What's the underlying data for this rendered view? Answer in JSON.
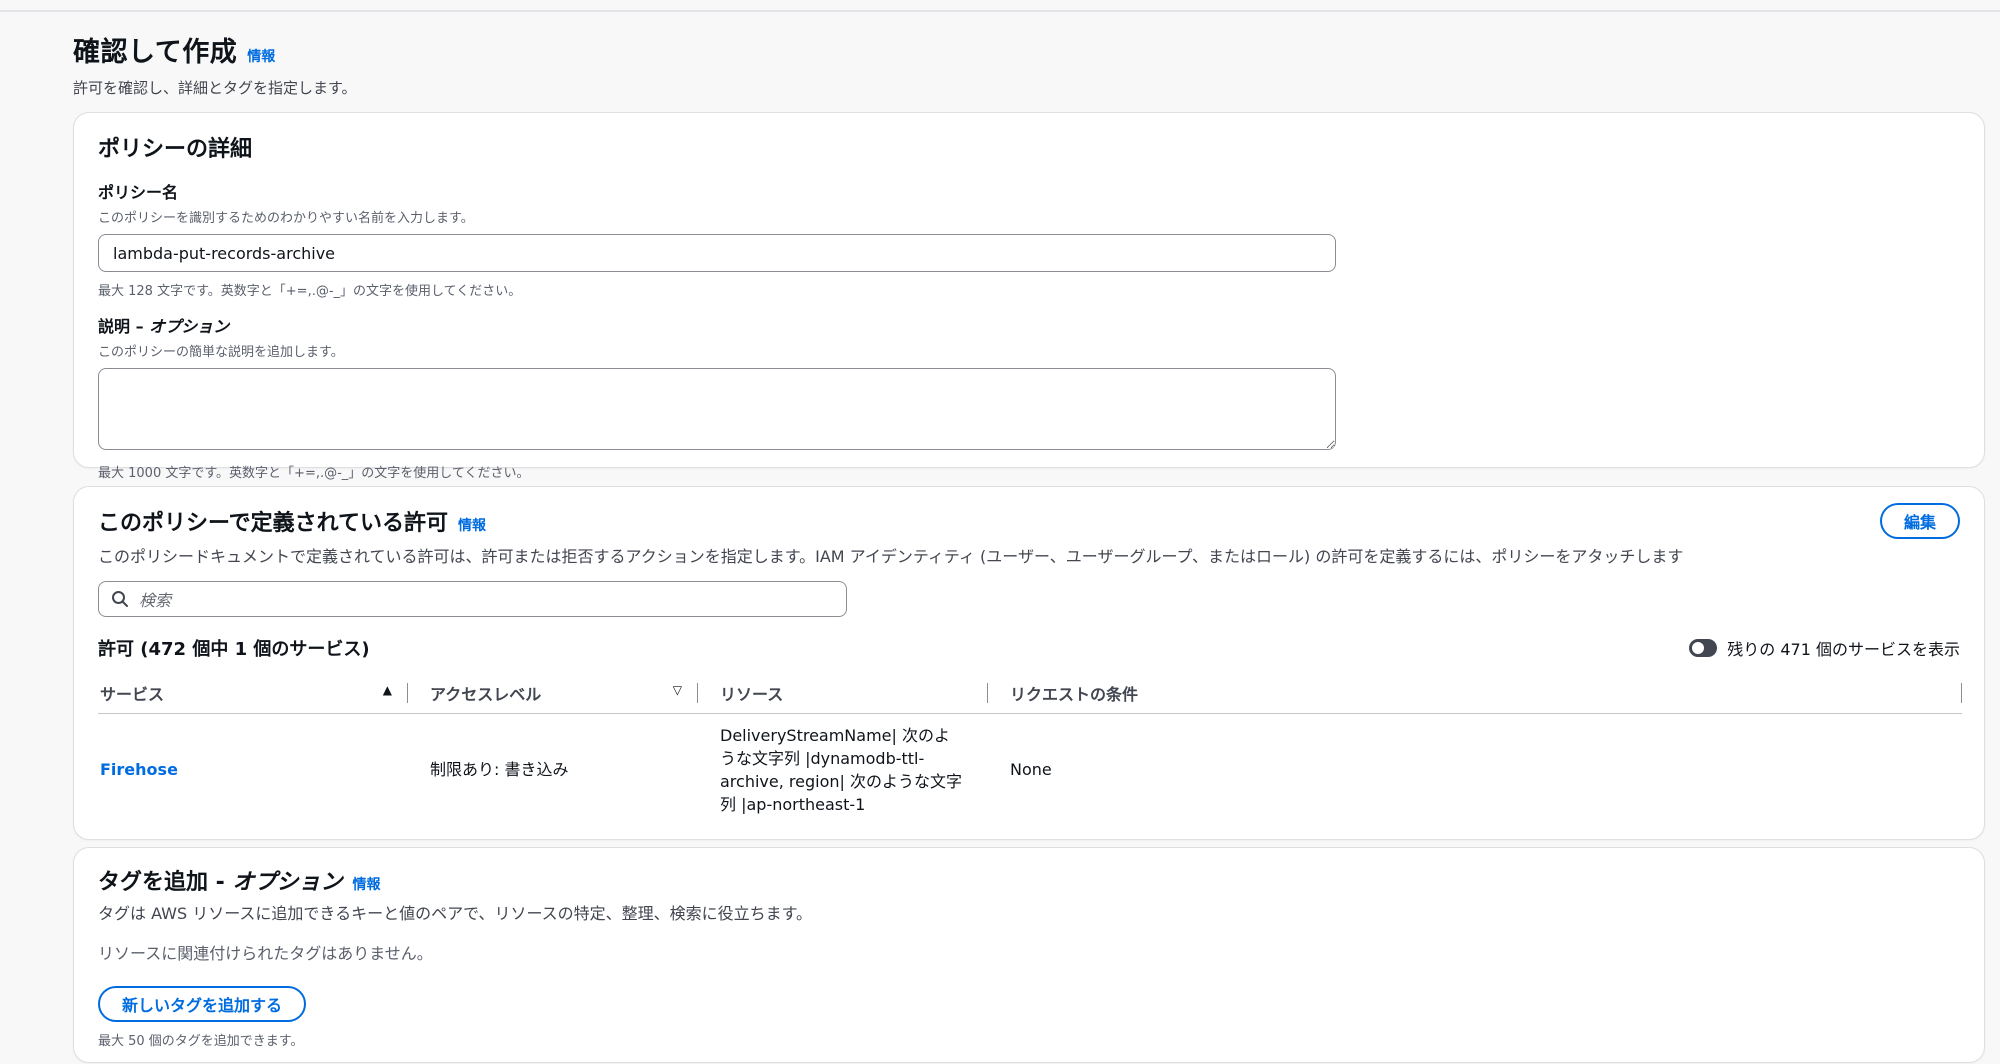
{
  "header": {
    "title": "確認して作成",
    "info": "情報",
    "description": "許可を確認し、詳細とタグを指定します。"
  },
  "policy_details": {
    "title": "ポリシーの詳細",
    "name_label": "ポリシー名",
    "name_desc": "このポリシーを識別するためのわかりやすい名前を入力します。",
    "name_value": "lambda-put-records-archive",
    "name_constraint": "最大 128 文字です。英数字と「+=,.@-_」の文字を使用してください。",
    "desc_label": "説明 – ",
    "desc_label_optional": "オプション",
    "desc_desc": "このポリシーの簡単な説明を追加します。",
    "desc_value": "",
    "desc_constraint": "最大 1000 文字です。英数字と「+=,.@-_」の文字を使用してください。"
  },
  "permissions": {
    "title": "このポリシーで定義されている許可",
    "info": "情報",
    "edit_label": "編集",
    "description": "このポリシードキュメントで定義されている許可は、許可または拒否するアクションを指定します。IAM アイデンティティ (ユーザー、ユーザーグループ、またはロール) の許可を定義するには、ポリシーをアタッチします",
    "search_placeholder": "検索",
    "count_title": "許可 (472 個中 1 個のサービス)",
    "toggle_label": "残りの 471 個のサービスを表示",
    "columns": [
      "サービス",
      "アクセスレベル",
      "リソース",
      "リクエストの条件"
    ],
    "rows": [
      {
        "service": "Firehose",
        "access_level": "制限あり: 書き込み",
        "resource": "DeliveryStreamName| 次のような文字列 |dynamodb-ttl-archive, region| 次のような文字列 |ap-northeast-1",
        "condition": "None"
      }
    ]
  },
  "tags": {
    "title": "タグを追加 - ",
    "title_optional": "オプション",
    "info": "情報",
    "description": "タグは AWS リソースに追加できるキーと値のペアで、リソースの特定、整理、検索に役立ちます。",
    "empty": "リソースに関連付けられたタグはありません。",
    "add_button": "新しいタグを追加する",
    "constraint": "最大 50 個のタグを追加できます。"
  }
}
